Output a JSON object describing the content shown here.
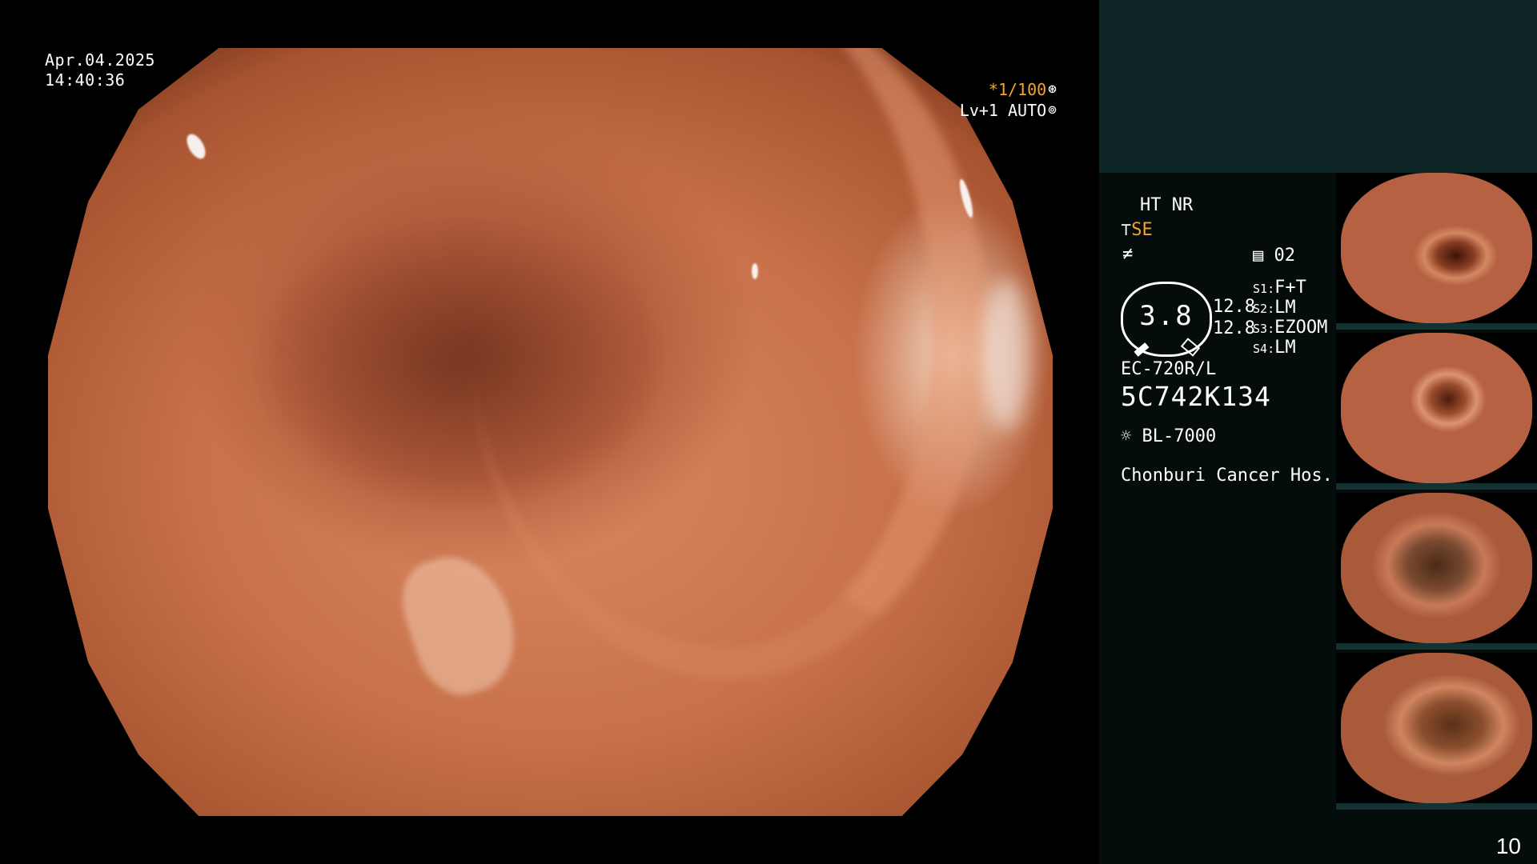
{
  "endoscopy_view": {
    "date": "Apr.04.2025",
    "time": "14:40:36",
    "shutter": "*1/100",
    "shutter_icon": "aperture-icon",
    "enhancement": "Lv+1 AUTO",
    "enhancement_icon": "iris-icon"
  },
  "info_panel": {
    "mode": "HT NR",
    "structure_enhancement": "SE",
    "structure_icon": "tilde-hook-icon",
    "color_icon": "slash-f-icon",
    "memory_icon": "memory-card-icon",
    "memory_count": "02",
    "gauge_value": "3.8",
    "gauge_side_top": "12.8",
    "gauge_side_bottom": "12.8",
    "switches": [
      {
        "key": "S1",
        "value": "F+T"
      },
      {
        "key": "S2",
        "value": "LM"
      },
      {
        "key": "S3",
        "value": "EZOOM"
      },
      {
        "key": "S4",
        "value": "LM"
      }
    ],
    "scope_model": "EC-720R/L",
    "scope_serial": "5C742K134",
    "light_icon": "sun-icon",
    "light_source": "BL-7000",
    "hospital": "Chonburi Cancer Hos."
  },
  "page_number": "10",
  "colors": {
    "panel_top": "#0f2626",
    "panel_bg": "#050c0c",
    "accent_orange": "#f4a428",
    "mucosa": "#c8714a"
  }
}
